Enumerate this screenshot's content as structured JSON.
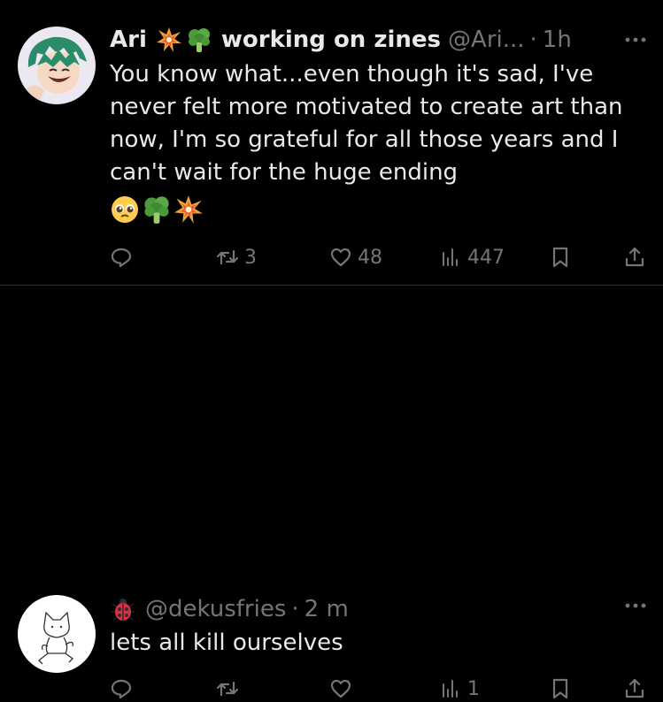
{
  "tweets": [
    {
      "name": "Ari",
      "name_suffix": "working on zines",
      "handle": "@Ari...",
      "separator": "·",
      "time": "1h",
      "text": "You know what...even though it's sad, I've never felt more motivated to create art than now, I'm so grateful for all those years and I can't wait for the huge ending",
      "body_emojis": [
        "pleading-face-icon",
        "broccoli-icon",
        "collision-icon"
      ],
      "actions": {
        "retweets": "3",
        "likes": "48",
        "views": "447"
      }
    },
    {
      "handle": "@dekusfries",
      "separator": "·",
      "time": "2 m",
      "text": "lets all kill ourselves",
      "actions": {
        "retweets": "",
        "likes": "",
        "views": "1"
      }
    }
  ],
  "colors": {
    "background": "#000000",
    "text": "#e7e9ea",
    "muted": "#71767b",
    "divider": "#2f3336"
  }
}
